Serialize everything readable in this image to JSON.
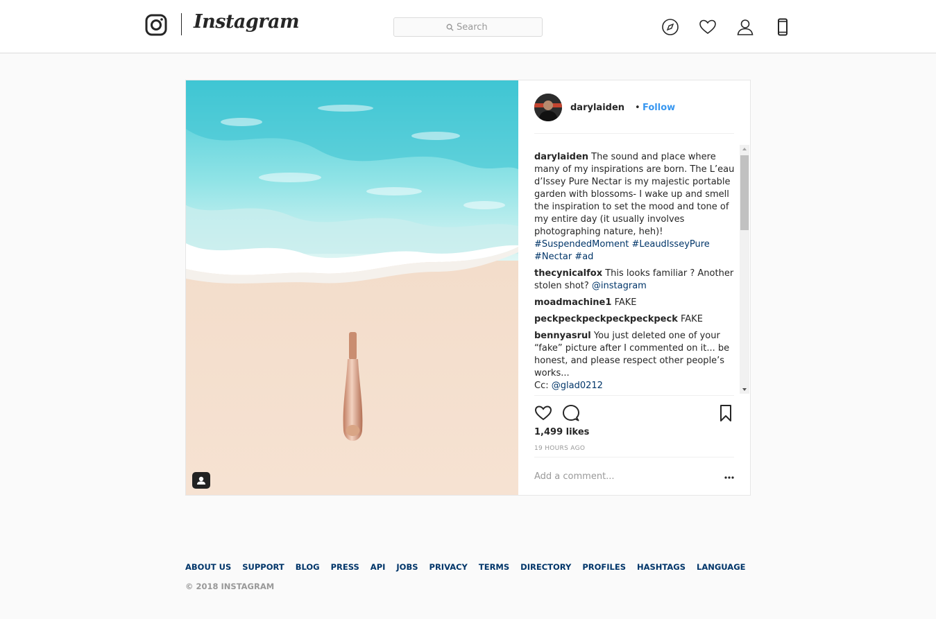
{
  "nav": {
    "wordmark": "Instagram",
    "search_placeholder": "Search"
  },
  "post": {
    "username": "darylaiden",
    "follow_separator": "•",
    "follow_label": "Follow",
    "likes": "1,499 likes",
    "time": "19 HOURS AGO",
    "add_comment_placeholder": "Add a comment...",
    "caption": {
      "user": "darylaiden",
      "text": "The sound and place where many of my inspirations are born. The L’eau d’Issey Pure Nectar is my majestic portable garden with blossoms- I wake up and smell the inspiration to set the mood and tone of my entire day (it usually involves photographing nature, heh)!",
      "hashtags": "#SuspendedMoment #LeaudIsseyPure #Nectar #ad"
    },
    "comments": [
      {
        "user": "thecynicalfox",
        "text": "This looks familiar ? Another stolen shot?",
        "mention": "@instagram"
      },
      {
        "user": "moadmachine1",
        "text": "FAKE",
        "mention": ""
      },
      {
        "user": "peckpeckpeckpeckpeckpeck",
        "text": "FAKE",
        "mention": ""
      },
      {
        "user": "bennyasrul",
        "text": "You just deleted one of your “fake” picture after I commented on it... be honest, and please respect other people’s works...",
        "prefix2": "Cc:",
        "mention": "@glad0212"
      }
    ]
  },
  "footer": {
    "links": [
      "ABOUT US",
      "SUPPORT",
      "BLOG",
      "PRESS",
      "API",
      "JOBS",
      "PRIVACY",
      "TERMS",
      "DIRECTORY",
      "PROFILES",
      "HASHTAGS",
      "LANGUAGE"
    ],
    "copyright": "© 2018 INSTAGRAM"
  },
  "colors": {
    "link": "#3897f0",
    "dark_link": "#003569",
    "sea": "#5fd6e0",
    "sand": "#f3dcc6"
  },
  "icons": [
    "instagram-logo-icon",
    "search-icon",
    "compass-icon",
    "heart-icon",
    "profile-icon",
    "mobile-icon",
    "like-icon",
    "comment-icon",
    "bookmark-icon",
    "more-options-icon",
    "user-tag-icon"
  ]
}
